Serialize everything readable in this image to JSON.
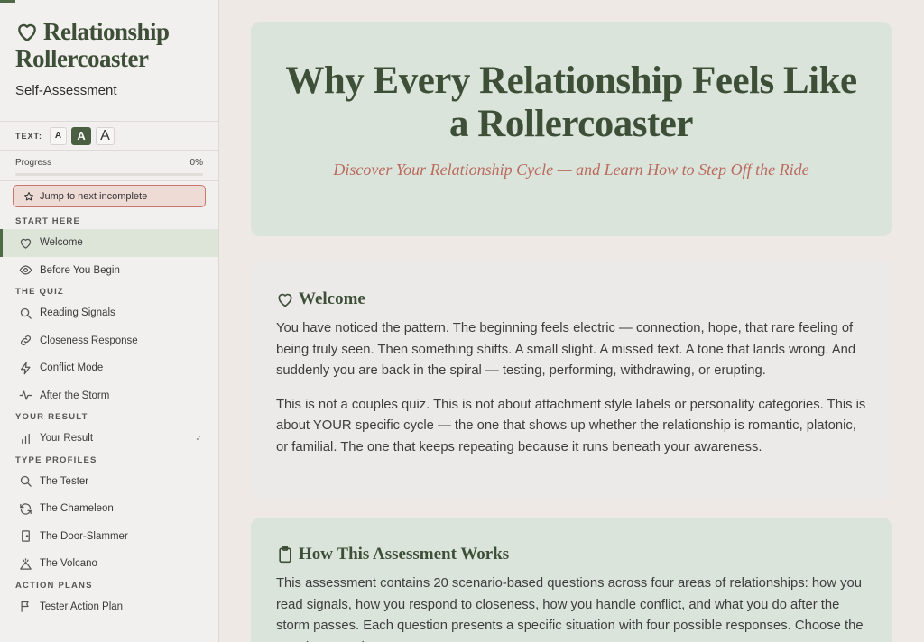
{
  "sidebar": {
    "title_line1": "Relationship",
    "title_line2": "Rollercoaster",
    "subtitle": "Self-Assessment",
    "text_size": {
      "label": "TEXT:",
      "small": "A",
      "medium": "A",
      "large": "A",
      "selected": "medium"
    },
    "progress": {
      "label": "Progress",
      "value_text": "0%",
      "value": 0
    },
    "jump_button": "Jump to next incomplete",
    "sections": [
      {
        "label": "START HERE",
        "items": [
          {
            "label": "Welcome",
            "icon": "heart-icon",
            "active": true
          },
          {
            "label": "Before You Begin",
            "icon": "eye-icon"
          }
        ]
      },
      {
        "label": "THE QUIZ",
        "items": [
          {
            "label": "Reading Signals",
            "icon": "search-icon"
          },
          {
            "label": "Closeness Response",
            "icon": "link-icon"
          },
          {
            "label": "Conflict Mode",
            "icon": "lightning-icon"
          },
          {
            "label": "After the Storm",
            "icon": "pulse-icon"
          }
        ]
      },
      {
        "label": "YOUR RESULT",
        "items": [
          {
            "label": "Your Result",
            "icon": "bar-chart-icon",
            "check": "✓"
          }
        ]
      },
      {
        "label": "TYPE PROFILES",
        "items": [
          {
            "label": "The Tester",
            "icon": "search-icon"
          },
          {
            "label": "The Chameleon",
            "icon": "refresh-icon"
          },
          {
            "label": "The Door-Slammer",
            "icon": "door-icon"
          },
          {
            "label": "The Volcano",
            "icon": "volcano-icon"
          }
        ]
      },
      {
        "label": "ACTION PLANS",
        "items": [
          {
            "label": "Tester Action Plan",
            "icon": "flag-icon"
          }
        ]
      }
    ]
  },
  "hero": {
    "title": "Why Every Relationship Feels Like a Rollercoaster",
    "subtitle": "Discover Your Relationship Cycle — and Learn How to Step Off the Ride"
  },
  "welcome": {
    "heading": "Welcome",
    "paragraphs": [
      "You have noticed the pattern. The beginning feels electric — connection, hope, that rare feeling of being truly seen. Then something shifts. A small slight. A missed text. A tone that lands wrong. And suddenly you are back in the spiral — testing, performing, withdrawing, or erupting.",
      "This is not a couples quiz. This is not about attachment style labels or personality categories. This is about YOUR specific cycle — the one that shows up whether the relationship is romantic, platonic, or familial. The one that keeps repeating because it runs beneath your awareness."
    ]
  },
  "how": {
    "heading": "How This Assessment Works",
    "paragraph": "This assessment contains 20 scenario-based questions across four areas of relationships: how you read signals, how you respond to closeness, how you handle conflict, and what you do after the storm passes. Each question presents a specific situation with four possible responses. Choose the one that sounds"
  },
  "colors": {
    "accent": "#4f6a46",
    "heading": "#3e4f38",
    "subtitle": "#b96a5d",
    "hero_bg": "#dbe4db"
  }
}
